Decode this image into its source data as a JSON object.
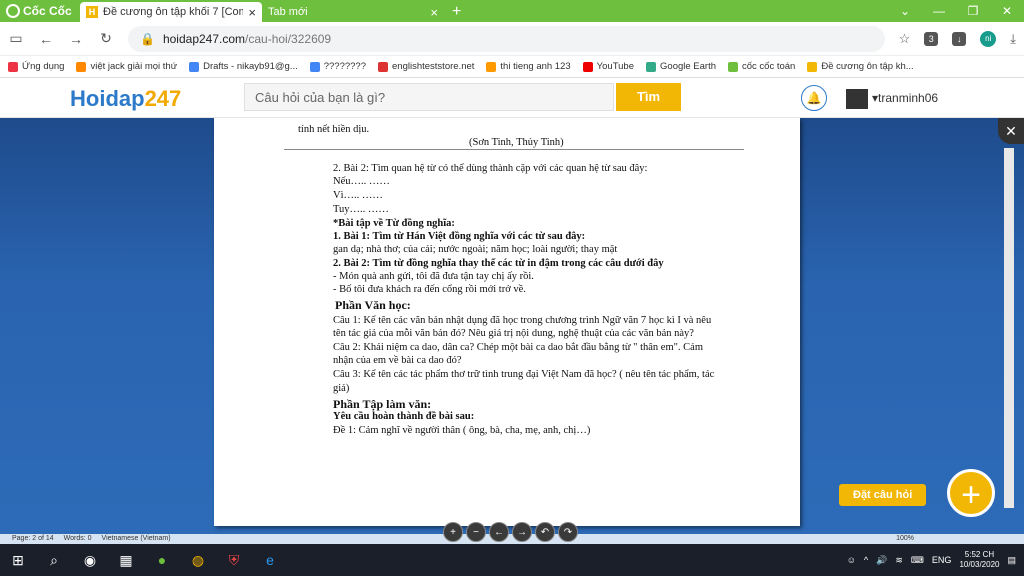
{
  "browser": {
    "brand": "Cốc Cốc",
    "tabs": [
      {
        "title": "Đề cương ôn tập khối 7 [Com",
        "active": true
      },
      {
        "title": "Tab mới",
        "active": false
      }
    ],
    "url_host": "hoidap247.com",
    "url_path": "/cau-hoi/322609"
  },
  "bookmarks": [
    {
      "label": "Ứng dụng",
      "color": "#e34"
    },
    {
      "label": "việt jack giải mọi thứ",
      "color": "#f80"
    },
    {
      "label": "Drafts - nikayb91@g...",
      "color": "#4285f4"
    },
    {
      "label": "????????",
      "color": "#4285f4"
    },
    {
      "label": "englishteststore.net",
      "color": "#d33"
    },
    {
      "label": "thi tieng anh 123",
      "color": "#f90"
    },
    {
      "label": "YouTube",
      "color": "#e00"
    },
    {
      "label": "Google Earth",
      "color": "#3a8"
    },
    {
      "label": "cốc cốc toán",
      "color": "#6fbf3e"
    },
    {
      "label": "Đề cương ôn tập kh...",
      "color": "#f2b705"
    }
  ],
  "site": {
    "logo_a": "Hoidap",
    "logo_b": "247",
    "search_placeholder": "Câu hỏi của bạn là gì?",
    "search_button": "Tìm",
    "username": "tranminh06"
  },
  "doc": {
    "lines": [
      "tính nết hiền dịu.",
      "(Sơn Tinh, Thủy Tinh)",
      "2. Bài 2: Tìm quan hệ từ có thể dùng thành cặp với các quan hệ từ sau đây:",
      "Nếu…..              ……",
      "Vì…..                ……",
      "Tuy…..              ……",
      "*Bài tập về Từ đồng nghĩa:",
      "1. Bài 1: Tìm từ Hán Việt đồng nghĩa với các từ sau đây:",
      "gan dạ; nhà thơ; của cải; nước ngoài; năm học; loài người; thay mặt",
      "2. Bài 2: Tìm từ đồng nghĩa thay thế các từ in đậm trong các câu dưới đây",
      "- Món quà anh gửi, tôi đã đưa tận tay chị ấy rồi.",
      "- Bố tôi đưa khách ra đến cổng rồi mới trở về.",
      "Phần Văn học:",
      "Câu 1: Kể tên các văn bản nhật dụng đã học trong chương trình Ngữ văn 7 học kì I và nêu",
      "tên tác giả của mỗi văn bản đó? Nêu giá trị nội dung, nghệ thuật của các văn bản này?",
      "Câu 2: Khái niệm ca dao, dân ca? Chép một bài ca dao bắt đầu bằng từ \" thân em\". Cảm",
      "nhận của em về bài ca dao đó?",
      "Câu 3: Kể tên các tác phẩm thơ trữ tình trung đại Việt Nam đã học? ( nêu tên tác phẩm, tác",
      "giả)",
      "Phần Tập làm văn:",
      "Yêu cầu hoàn thành đề bài sau:",
      "Đề 1: Cảm nghĩ về người thân ( ông, bà, cha, mẹ, anh, chị…)"
    ]
  },
  "status": {
    "page": "Page: 2 of 14",
    "words": "Words: 0",
    "lang": "Vietnamese (Vietnam)",
    "zoom": "100%"
  },
  "actions": {
    "ask": "Đặt câu hỏi"
  },
  "taskbar": {
    "lang": "ENG",
    "time": "5:52 CH",
    "date": "10/03/2020"
  }
}
